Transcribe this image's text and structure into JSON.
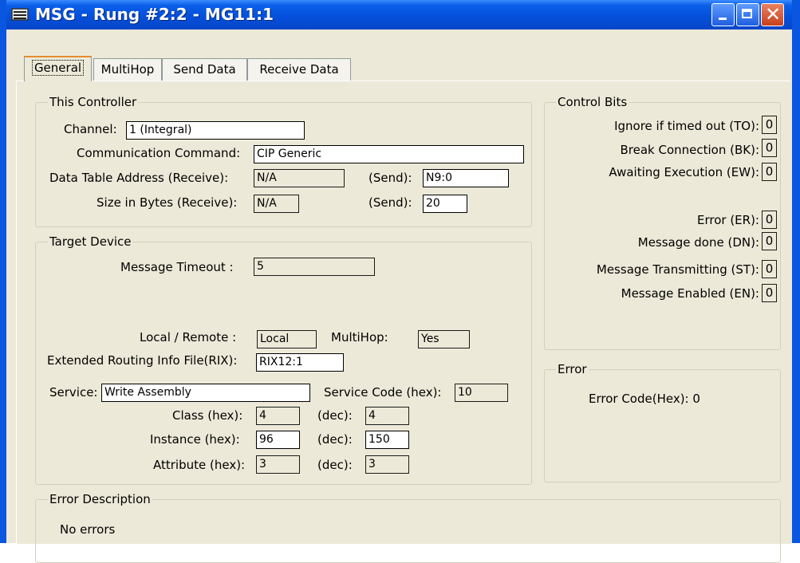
{
  "window": {
    "title": "MSG - Rung #2:2 - MG11:1"
  },
  "tabs": [
    "General",
    "MultiHop",
    "Send Data",
    "Receive Data"
  ],
  "this_controller": {
    "legend": "This Controller",
    "channel_label": "Channel:",
    "channel_value": "1 (Integral)",
    "comm_cmd_label": "Communication Command:",
    "comm_cmd_value": "CIP Generic",
    "dta_label": "Data Table Address (Receive):",
    "dta_receive": "N/A",
    "send_label": "(Send):",
    "dta_send": "N9:0",
    "size_label": "Size in Bytes (Receive):",
    "size_receive": "N/A",
    "size_send": "20"
  },
  "target_device": {
    "legend": "Target Device",
    "timeout_label": "Message Timeout :",
    "timeout_value": "5",
    "local_remote_label": "Local / Remote :",
    "local_remote_value": "Local",
    "multihop_label": "MultiHop:",
    "multihop_value": "Yes",
    "rix_label": "Extended Routing Info File(RIX):",
    "rix_value": "RIX12:1",
    "service_label": "Service:",
    "service_value": "Write Assembly",
    "service_code_label": "Service Code (hex):",
    "service_code_value": "10",
    "class_label": "Class (hex):",
    "class_hex": "4",
    "class_dec": "4",
    "instance_label": "Instance (hex):",
    "instance_hex": "96",
    "instance_dec": "150",
    "attribute_label": "Attribute (hex):",
    "attribute_hex": "3",
    "attribute_dec": "3",
    "dec_label": "(dec):"
  },
  "control_bits": {
    "legend": "Control Bits",
    "items": [
      {
        "label": "Ignore if timed out (TO):",
        "value": "0"
      },
      {
        "label": "Break Connection (BK):",
        "value": "0"
      },
      {
        "label": "Awaiting Execution (EW):",
        "value": "0"
      },
      {
        "label": "Error (ER):",
        "value": "0"
      },
      {
        "label": "Message done (DN):",
        "value": "0"
      },
      {
        "label": "Message Transmitting (ST):",
        "value": "0"
      },
      {
        "label": "Message Enabled (EN):",
        "value": "0"
      }
    ]
  },
  "error": {
    "legend": "Error",
    "code_text": "Error Code(Hex): 0"
  },
  "error_description": {
    "legend": "Error Description",
    "text": "No errors"
  },
  "colors": {
    "titlebar": "#0550dc",
    "face": "#ece9d8",
    "active_tab_accent": "#e68b2c"
  }
}
